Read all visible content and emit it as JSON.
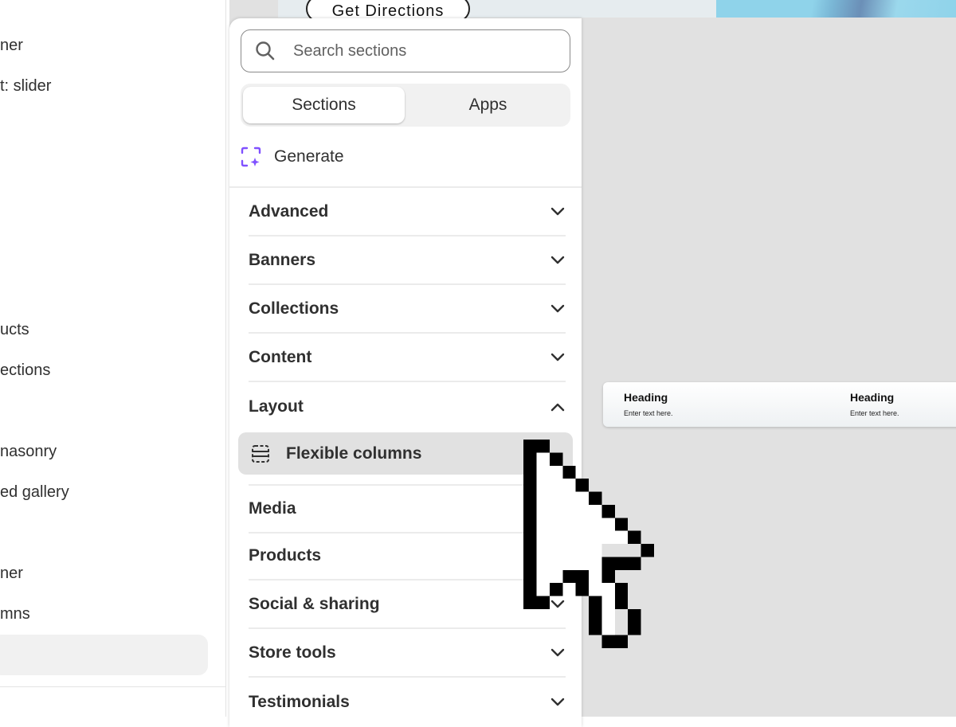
{
  "left_sidebar": {
    "items": [
      {
        "label": "ner"
      },
      {
        "label": "t: slider"
      },
      {
        "label": "ucts"
      },
      {
        "label": "ections"
      },
      {
        "label": "nasonry"
      },
      {
        "label": "ed gallery"
      },
      {
        "label": "ner"
      },
      {
        "label": "mns"
      }
    ]
  },
  "preview": {
    "directions_button": "Get Directions",
    "columns": [
      {
        "heading": "Heading",
        "text": "Enter text here."
      },
      {
        "heading": "Heading",
        "text": "Enter text here."
      }
    ]
  },
  "picker": {
    "search": {
      "placeholder": "Search sections",
      "value": ""
    },
    "tabs": [
      {
        "label": "Sections",
        "active": true
      },
      {
        "label": "Apps",
        "active": false
      }
    ],
    "generate_label": "Generate",
    "categories": [
      {
        "label": "Advanced",
        "expanded": false
      },
      {
        "label": "Banners",
        "expanded": false
      },
      {
        "label": "Collections",
        "expanded": false
      },
      {
        "label": "Content",
        "expanded": false
      },
      {
        "label": "Layout",
        "expanded": true
      },
      {
        "label": "Media",
        "expanded": false
      },
      {
        "label": "Products",
        "expanded": false
      },
      {
        "label": "Social & sharing",
        "expanded": false
      },
      {
        "label": "Store tools",
        "expanded": false
      },
      {
        "label": "Testimonials",
        "expanded": false
      }
    ],
    "layout_items": [
      {
        "label": "Flexible columns",
        "icon": "columns-layout-icon",
        "hovered": true
      }
    ]
  },
  "colors": {
    "accent_purple": "#8051ff",
    "canvas_bg": "#e1e1e1",
    "text": "#303030"
  }
}
